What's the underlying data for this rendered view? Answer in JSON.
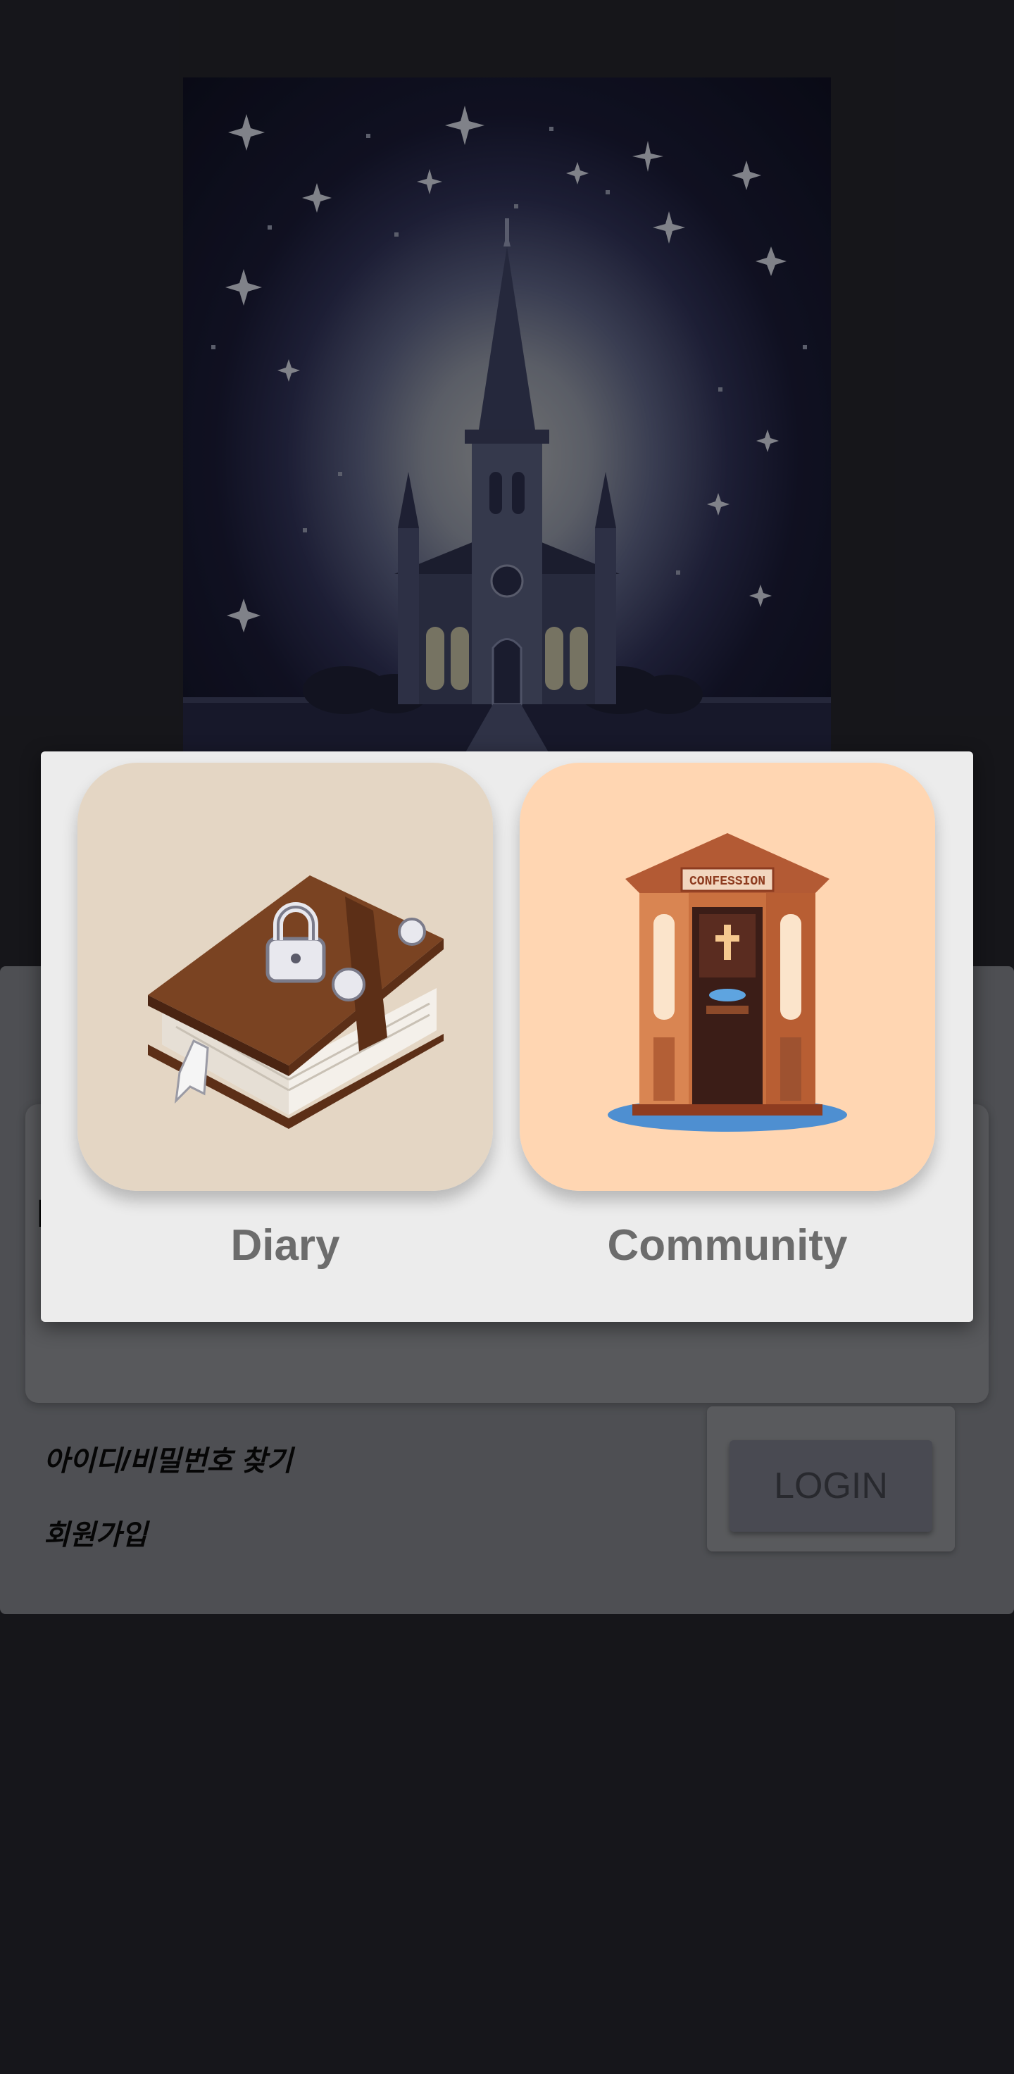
{
  "app": {
    "hero_image": "church-night-icon"
  },
  "login": {
    "pw_label": "PW",
    "find_link": "아이디/비밀번호 찾기",
    "signup_link": "회원가입",
    "login_button": "LOGIN"
  },
  "dialog": {
    "options": [
      {
        "label": "Diary",
        "icon": "locked-book-icon",
        "bg": "#e4d6c4"
      },
      {
        "label": "Community",
        "icon": "confession-booth-icon",
        "bg": "#ffd6b2"
      }
    ]
  },
  "colors": {
    "scrim": "#000000",
    "dialog_bg": "#ececec",
    "label_text": "#6c6c6c"
  }
}
